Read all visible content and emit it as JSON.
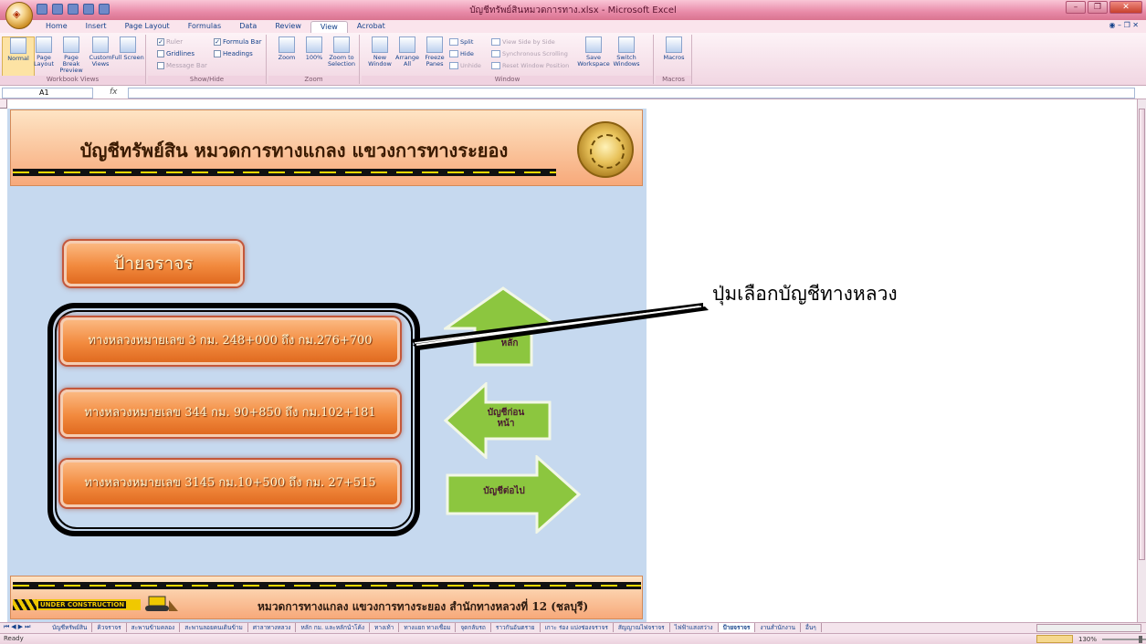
{
  "window": {
    "title": "บัญชีทรัพย์สินหมวดการทาง.xlsx - Microsoft Excel"
  },
  "ribbon_tabs": [
    "Home",
    "Insert",
    "Page Layout",
    "Formulas",
    "Data",
    "Review",
    "View",
    "Acrobat"
  ],
  "active_tab": "View",
  "ribbon": {
    "workbook_views": {
      "label": "Workbook Views",
      "normal": "Normal",
      "page_layout": "Page Layout",
      "page_break": "Page Break Preview",
      "custom_views": "Custom Views",
      "full_screen": "Full Screen"
    },
    "show_hide": {
      "label": "Show/Hide",
      "ruler": "Ruler",
      "gridlines": "Gridlines",
      "message_bar": "Message Bar",
      "formula_bar": "Formula Bar",
      "headings": "Headings"
    },
    "zoom": {
      "label": "Zoom",
      "zoom": "Zoom",
      "zoom100": "100%",
      "zoom_sel": "Zoom to Selection"
    },
    "window": {
      "label": "Window",
      "new_window": "New Window",
      "arrange_all": "Arrange All",
      "freeze": "Freeze Panes",
      "split": "Split",
      "hide": "Hide",
      "unhide": "Unhide",
      "side_by_side": "View Side by Side",
      "sync_scroll": "Synchronous Scrolling",
      "reset_pos": "Reset Window Position",
      "save_ws": "Save Workspace",
      "switch": "Switch Windows"
    },
    "macros": {
      "label": "Macros",
      "macros": "Macros"
    }
  },
  "formula_bar": {
    "name_box": "A1",
    "fx": "fx",
    "value": ""
  },
  "sheet": {
    "header_title": "บัญชีทรัพย์สิน  หมวดการทางแกลง  แขวงการทางระยอง",
    "sign_button": "ป้ายจราจร",
    "highway_buttons": [
      "ทางหลวงหมายเลข 3 กม. 248+000 ถึง กม.276+700",
      "ทางหลวงหมายเลข 344 กม. 90+850 ถึง กม.102+181",
      "ทางหลวงหมายเลข 3145 กม.10+500 ถึง กม. 27+515"
    ],
    "arrows": {
      "main": "หลัก",
      "previous": "บัญชีก่อน หน้า",
      "next": "บัญชีต่อไป"
    },
    "callout": "ปุ่มเลือกบัญชีทางหลวง",
    "footer_uc": "UNDER CONSTRUCTION",
    "footer_text": "หมวดการทางแกลง แขวงการทางระยอง สำนักทางหลวงที่ 12 (ชลบุรี)"
  },
  "sheet_tabs": [
    "บัญชีทรัพย์สิน",
    "คิวจราจร",
    "สะพานข้ามคลอง",
    "สะพานลอยคนเดินข้าม",
    "ศาลาทางหลวง",
    "หลัก กม. และหลักนำโค้ง",
    "ทางเท้า",
    "ทางแยก ทางเชื่อม",
    "จุดกลับรถ",
    "ราวกันอันตราย",
    "เกาะ ร่อง แบ่งช่องจราจร",
    "สัญญาณไฟจราจร",
    "ไฟฟ้าแสงสว่าง",
    "ป้ายจราจร",
    "งานสำนักงาน",
    "อื่นๆ"
  ],
  "active_sheet": "ป้ายจราจร",
  "status": {
    "ready": "Ready",
    "zoom": "130%"
  },
  "colors": {
    "sheet_bg": "#c6d9ef",
    "button_orange": "#f28a3e",
    "arrow_green": "#8cc63f",
    "title_bar": "#e88aa8"
  }
}
